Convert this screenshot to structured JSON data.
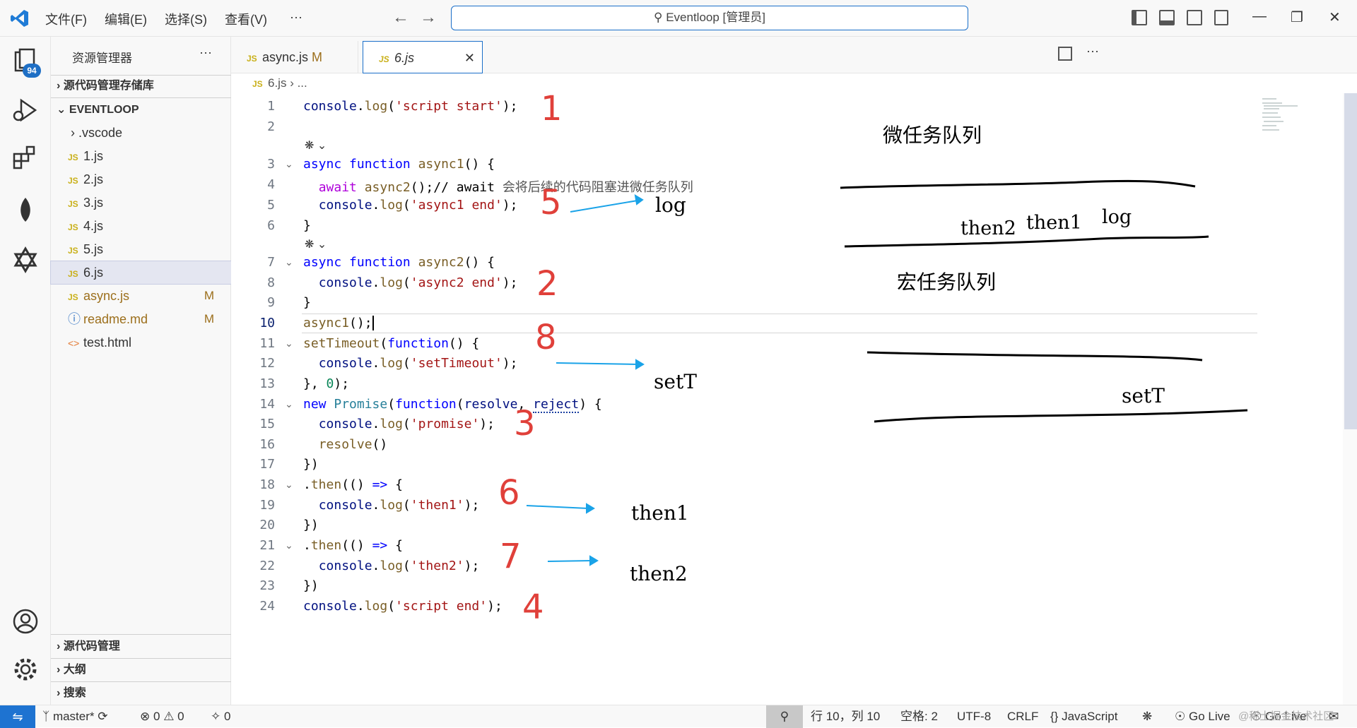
{
  "menu": {
    "file": "文件(F)",
    "edit": "编辑(E)",
    "select": "选择(S)",
    "view": "查看(V)",
    "more": "···"
  },
  "search": {
    "text": "Eventloop [管理员]"
  },
  "activity": {
    "badge": "94"
  },
  "sidebar": {
    "title": "资源管理器",
    "more": "···",
    "scm_repo": "源代码管理存储库",
    "folder": "EVENTLOOP",
    "items": [
      {
        "label": ".vscode",
        "type": "folder"
      },
      {
        "label": "1.js",
        "type": "js"
      },
      {
        "label": "2.js",
        "type": "js"
      },
      {
        "label": "3.js",
        "type": "js"
      },
      {
        "label": "4.js",
        "type": "js"
      },
      {
        "label": "5.js",
        "type": "js"
      },
      {
        "label": "6.js",
        "type": "js"
      },
      {
        "label": "async.js",
        "type": "js",
        "flag": "M"
      },
      {
        "label": "readme.md",
        "type": "info",
        "flag": "M"
      },
      {
        "label": "test.html",
        "type": "html"
      }
    ],
    "bottom": [
      "源代码管理",
      "大纲",
      "搜索"
    ]
  },
  "tabs": [
    {
      "label": "async.js",
      "flag": "M"
    },
    {
      "label": "6.js"
    }
  ],
  "breadcrumb": {
    "file": "6.js",
    "rest": "..."
  },
  "code": {
    "l1": "console.log('script start');",
    "l4_comment": "// await 会将后续的代码阻塞进微任务队列"
  },
  "annotations": {
    "micro_title": "微任务队列",
    "macro_title": "宏任务队列",
    "log1": "log",
    "then2": "then2",
    "then1": "then1",
    "log2": "log",
    "setT1": "setT",
    "setT2": "setT",
    "then1_out": "then1",
    "then2_out": "then2",
    "n1": "1",
    "n2": "2",
    "n3": "3",
    "n4": "4",
    "n5": "5",
    "n6": "6",
    "n7": "7",
    "n8": "8"
  },
  "status": {
    "branch": "master*",
    "errors": "0",
    "warnings": "0",
    "ports": "0",
    "position": "行 10，列 10",
    "spaces": "空格: 2",
    "encoding": "UTF-8",
    "eol": "CRLF",
    "lang": "JavaScript",
    "golive": "Go Live",
    "golive2": "Go Live",
    "watermark": "@稀土掘金技术社区"
  }
}
